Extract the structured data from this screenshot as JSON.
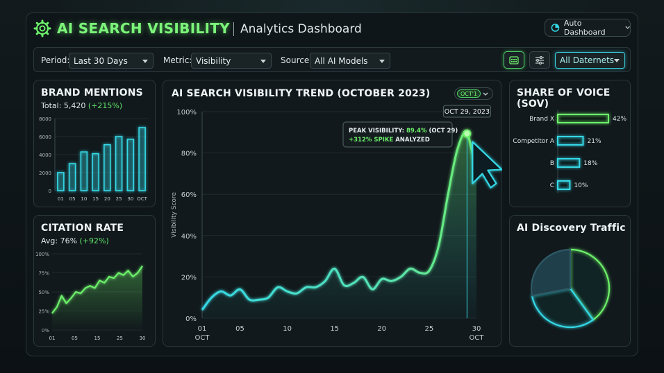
{
  "header": {
    "title": "AI SEARCH VISIBILITY",
    "subtitle": "Analytics Dashboard",
    "auto_dashboard_label": "Auto Dashboard"
  },
  "filters": {
    "period_label": "Period:",
    "period_value": "Last 30 Days",
    "metric_label": "Metric:",
    "metric_value": "Visibility",
    "source_label": "Source:",
    "source_value": "All AI Models",
    "datanet_value": "All Daternets"
  },
  "brand_mentions": {
    "title": "BRAND MENTIONS",
    "total_label": "Total: 5,420",
    "change": "(+215%)",
    "chart_data": {
      "type": "bar",
      "categories": [
        "01",
        "",
        "05",
        "",
        "10",
        "",
        "15",
        "",
        "20",
        "",
        "25",
        "",
        "30",
        "OCT"
      ],
      "tick_labels": [
        "01",
        "05",
        "10",
        "15",
        "20",
        "25",
        "30",
        "OCT"
      ],
      "values": [
        2000,
        3000,
        4300,
        4100,
        5100,
        6000,
        5700,
        7000
      ],
      "ylim": [
        0,
        8000
      ],
      "yticks": [
        "0",
        "2000",
        "4000",
        "6000",
        "8000"
      ]
    }
  },
  "citation_rate": {
    "title": "CITATION RATE",
    "avg_label": "Avg: 76%",
    "change": "(+92%)",
    "chart_data": {
      "type": "line",
      "x_ticks": [
        "01",
        "05",
        "15",
        "25",
        "30"
      ],
      "values": [
        22,
        30,
        45,
        35,
        42,
        50,
        48,
        55,
        58,
        55,
        65,
        62,
        70,
        68,
        75,
        72,
        78,
        70,
        75,
        84
      ],
      "ylim": [
        0,
        100
      ],
      "yticks": [
        "0%",
        "25%",
        "50%",
        "75%",
        "100%"
      ]
    }
  },
  "trend": {
    "title": "AI SEARCH VISIBILITY TREND (OCTOBER 2023)",
    "toggle_label": "OCT'1",
    "ylabel": "Visibility Score",
    "date_badge": "OCT 29, 2023",
    "peak_label": "PEAK VISIBILITY:",
    "peak_value": "89.4%",
    "peak_date": "(OCT 29)",
    "spike_value": "+312% SPIKE",
    "spike_label": "ANALYZED",
    "chart_data": {
      "type": "area",
      "x": [
        1,
        2,
        3,
        4,
        5,
        6,
        7,
        8,
        9,
        10,
        11,
        12,
        13,
        14,
        15,
        16,
        17,
        18,
        19,
        20,
        21,
        22,
        23,
        24,
        25,
        26,
        27,
        28,
        29,
        30
      ],
      "values": [
        4,
        10,
        13,
        11,
        14,
        9,
        9,
        10,
        15,
        13,
        12,
        15,
        15,
        18,
        24,
        16,
        17,
        20,
        14,
        19,
        18,
        20,
        24,
        22,
        23,
        35,
        60,
        82,
        89.4,
        70
      ],
      "ylim": [
        0,
        100
      ],
      "yticks": [
        "0%",
        "20%",
        "40%",
        "60%",
        "80%",
        "100%"
      ],
      "xticks": [
        "01",
        "05",
        "10",
        "15",
        "20",
        "25",
        "30"
      ],
      "xtick_values": [
        1,
        5,
        10,
        15,
        20,
        25,
        30
      ],
      "x_sub_first": "OCT",
      "x_sub_last": "OCT"
    }
  },
  "sov": {
    "title": "SHARE OF VOICE (SOV)",
    "chart_data": {
      "type": "bar",
      "categories": [
        "Brand X",
        "Competitor A",
        "B",
        "C"
      ],
      "values": [
        42,
        21,
        18,
        10
      ],
      "labels": [
        "42%",
        "21%",
        "18%",
        "10%"
      ]
    }
  },
  "discovery": {
    "title": "AI Discovery Traffic",
    "chart_data": {
      "type": "pie",
      "values": [
        40,
        32,
        28
      ],
      "colors": [
        "#6df06a",
        "#35d8e6",
        "#1f3f4a"
      ]
    }
  },
  "colors": {
    "accent_green": "#6df06a",
    "accent_cyan": "#35d8e6"
  }
}
